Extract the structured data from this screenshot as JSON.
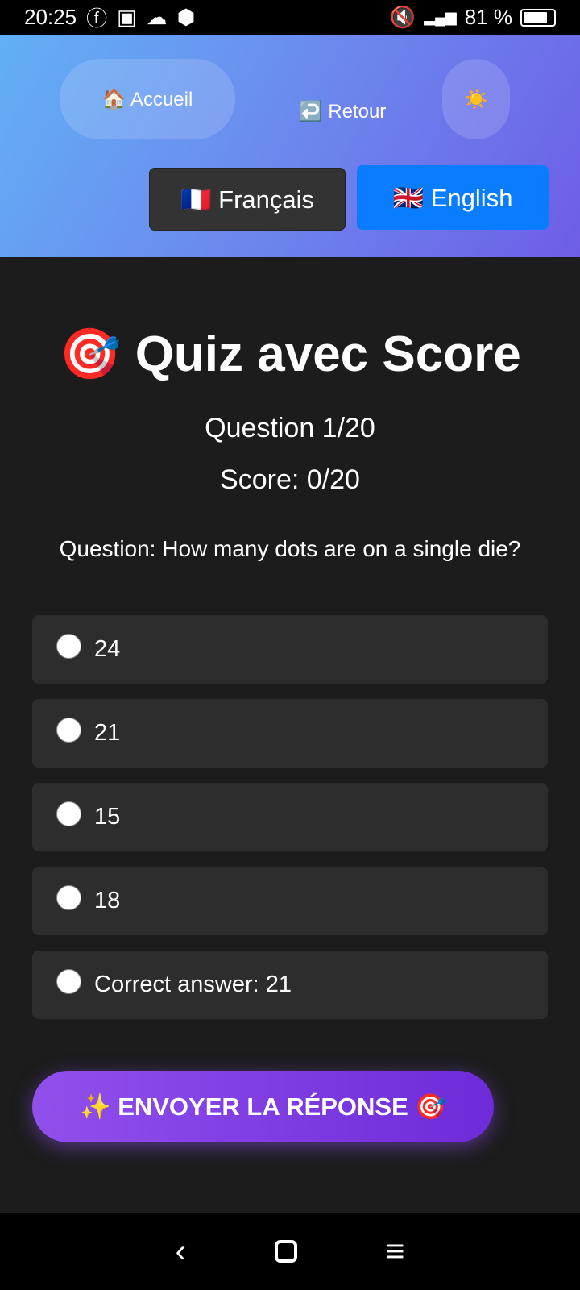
{
  "status": {
    "time": "20:25",
    "battery": "81 %",
    "network": "4G"
  },
  "header": {
    "home": "🏠 Accueil",
    "back": "↩️ Retour",
    "theme": "☀️",
    "lang_fr": "🇫🇷 Français",
    "lang_en": "🇬🇧 English"
  },
  "quiz": {
    "title": "🎯 Quiz avec Score",
    "progress": "Question 1/20",
    "score": "Score: 0/20",
    "question": "Question: How many dots are on a single die?",
    "options": [
      "24",
      "21",
      "15",
      "18",
      "Correct answer: 21"
    ],
    "submit": "✨ ENVOYER LA RÉPONSE 🎯"
  }
}
